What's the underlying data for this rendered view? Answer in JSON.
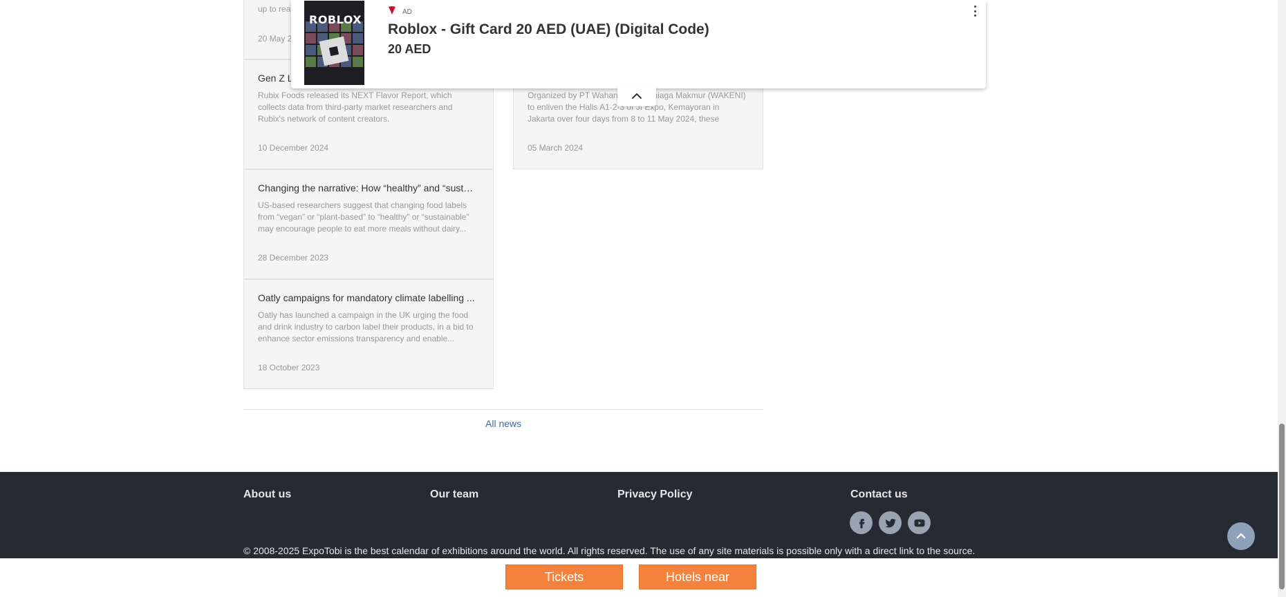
{
  "news_left": [
    {
      "title": "",
      "desc": "up to rea",
      "date": "20 May 2"
    },
    {
      "title": "Gen Z L",
      "desc": "Rubix Foods released its NEXT Flavor Report, which collects data from third-party market researchers and Rubix's network of content creators.",
      "date": "10 December 2024"
    },
    {
      "title": "Changing the narrative: How “healthy” and “sustai...",
      "desc": "US-based researchers suggest that changing food labels from “vegan” or “plant-based” to “healthy” or “sustainable” may encourage people to eat more meals without dairy...",
      "date": "28 December 2023"
    },
    {
      "title": "Oatly campaigns for mandatory climate labelling ...",
      "desc": "Oatly has launched a campaign in the UK urging the food and drink industry to carbon label their products, in a bid to enhance sector emissions transparency and enable...",
      "date": "18 October 2023"
    }
  ],
  "news_right": [
    {
      "title": "",
      "desc": "Organized by PT Wahana Kemalaniaga Makmur (WAKENI) to enliven the Halls A1-2-3 of JI Expo, Kemayoran in Jakarta over four days from 8 to 11 May 2024, these exhibitions p...",
      "date": "05 March 2024"
    }
  ],
  "all_news_label": "All news",
  "footer": {
    "about": "About us",
    "team": "Our team",
    "privacy": "Privacy Policy",
    "contact": "Contact us",
    "copyright": "© 2008-2025 ExpoTobi is the best calendar of exhibitions around the world. All rights reserved. The use of any site materials is possible only with a direct link to the source."
  },
  "bottom_bar": {
    "tickets": "Tickets",
    "hotels": "Hotels near"
  },
  "ad": {
    "label": "AD",
    "title": "Roblox - Gift Card 20 AED (UAE) (Digital Code)",
    "price": "20 AED",
    "thumb_logo": "ROBLOX",
    "brand_icon": "virgin"
  },
  "icons": {
    "facebook": "facebook-icon",
    "twitter": "twitter-icon",
    "youtube": "youtube-icon",
    "scroll_top": "chevron-up-icon",
    "ad_menu": "more-vertical-icon",
    "ad_collapse": "chevron-up-icon"
  },
  "colors": {
    "footer_bg": "#262a33",
    "button_orange": "#f5823c",
    "link_blue": "#3d6ca3"
  }
}
